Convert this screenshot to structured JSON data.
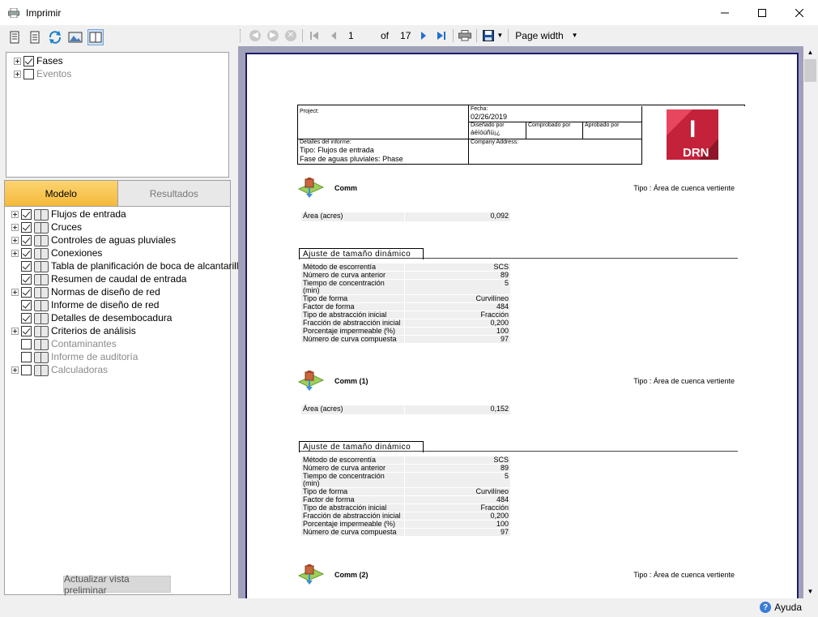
{
  "window": {
    "title": "Imprimir",
    "minimize": "—",
    "maximize": "☐",
    "close": "✕"
  },
  "fases_tree": [
    {
      "label": "Fases",
      "checked": true,
      "enabled": true
    },
    {
      "label": "Eventos",
      "checked": false,
      "enabled": false
    }
  ],
  "tabs": {
    "modelo": "Modelo",
    "resultados": "Resultados"
  },
  "model_tree": [
    {
      "label": "Flujos de entrada",
      "checked": true,
      "expand": true,
      "enabled": true
    },
    {
      "label": "Cruces",
      "checked": true,
      "expand": true,
      "enabled": true
    },
    {
      "label": "Controles de aguas pluviales",
      "checked": true,
      "expand": true,
      "enabled": true
    },
    {
      "label": "Conexiones",
      "checked": true,
      "expand": true,
      "enabled": true
    },
    {
      "label": "Tabla de planificación de boca de alcantarilla",
      "checked": true,
      "expand": false,
      "enabled": true
    },
    {
      "label": "Resumen de caudal de entrada",
      "checked": true,
      "expand": false,
      "enabled": true
    },
    {
      "label": "Normas de diseño de red",
      "checked": true,
      "expand": true,
      "enabled": true
    },
    {
      "label": "Informe de diseño de red",
      "checked": true,
      "expand": false,
      "enabled": true
    },
    {
      "label": "Detalles de desembocadura",
      "checked": true,
      "expand": false,
      "enabled": true
    },
    {
      "label": "Criterios de análisis",
      "checked": true,
      "expand": true,
      "enabled": true
    },
    {
      "label": "Contaminantes",
      "checked": false,
      "expand": false,
      "enabled": false
    },
    {
      "label": "Informe de auditoría",
      "checked": false,
      "expand": false,
      "enabled": false
    },
    {
      "label": "Calculadoras",
      "checked": false,
      "expand": true,
      "enabled": false
    }
  ],
  "update_button": "Actualizar vista preliminar",
  "report_toolbar": {
    "page": "1",
    "of_label": "of",
    "total_pages": "17",
    "zoom": "Page width"
  },
  "report": {
    "header": {
      "project_label": "Project:",
      "fecha_label": "Fecha:",
      "fecha": "02/26/2019",
      "disenado_label": "Diseñado por",
      "disenado_value": "áéíóúñü¡¿",
      "comprobado_label": "Comprobado por",
      "aprobado_label": "Aprobado por",
      "detalles_label": "Detalles del informe:",
      "tipo_line": "Tipo: Flujos de entrada",
      "fase_line": "Fase de aguas pluviales: Phase",
      "company_label": "Company Address:",
      "logo_letter": "I",
      "logo_text": "DRN"
    },
    "sections": [
      {
        "name": "Comm",
        "tipo": "Tipo : Área de cuenca vertiente",
        "area_label": "Área (acres)",
        "area_value": "0,092",
        "ajuste_title": "Ajuste de tamaño dinámico",
        "rows": [
          {
            "k": "Método de escorrentía",
            "v": "SCS"
          },
          {
            "k": "Número de curva anterior",
            "v": "89"
          },
          {
            "k": "Tiempo de concentración (min)",
            "v": "5"
          },
          {
            "k": "Tipo de forma",
            "v": "Curvilíneo"
          },
          {
            "k": "Factor de forma",
            "v": "484"
          },
          {
            "k": "Tipo de abstracción inicial",
            "v": "Fracción"
          },
          {
            "k": "Fracción de abstracción inicial",
            "v": "0,200"
          },
          {
            "k": "Porcentaje impermeable (%)",
            "v": "100"
          },
          {
            "k": "Número de curva compuesta",
            "v": "97"
          }
        ]
      },
      {
        "name": "Comm (1)",
        "tipo": "Tipo : Área de cuenca vertiente",
        "area_label": "Área (acres)",
        "area_value": "0,152",
        "ajuste_title": "Ajuste de tamaño dinámico",
        "rows": [
          {
            "k": "Método de escorrentía",
            "v": "SCS"
          },
          {
            "k": "Número de curva anterior",
            "v": "89"
          },
          {
            "k": "Tiempo de concentración (min)",
            "v": "5"
          },
          {
            "k": "Tipo de forma",
            "v": "Curvilíneo"
          },
          {
            "k": "Factor de forma",
            "v": "484"
          },
          {
            "k": "Tipo de abstracción inicial",
            "v": "Fracción"
          },
          {
            "k": "Fracción de abstracción inicial",
            "v": "0,200"
          },
          {
            "k": "Porcentaje impermeable (%)",
            "v": "100"
          },
          {
            "k": "Número de curva compuesta",
            "v": "97"
          }
        ]
      },
      {
        "name": "Comm (2)",
        "tipo": "Tipo : Área de cuenca vertiente"
      }
    ]
  },
  "status": {
    "help": "Ayuda",
    "help_icon": "?"
  },
  "colors": {
    "tab_active": "#f5b93a",
    "page_border": "#1c1c6b",
    "logo_red": "#c4223a",
    "viewer_bg": "#a0a0b8"
  }
}
